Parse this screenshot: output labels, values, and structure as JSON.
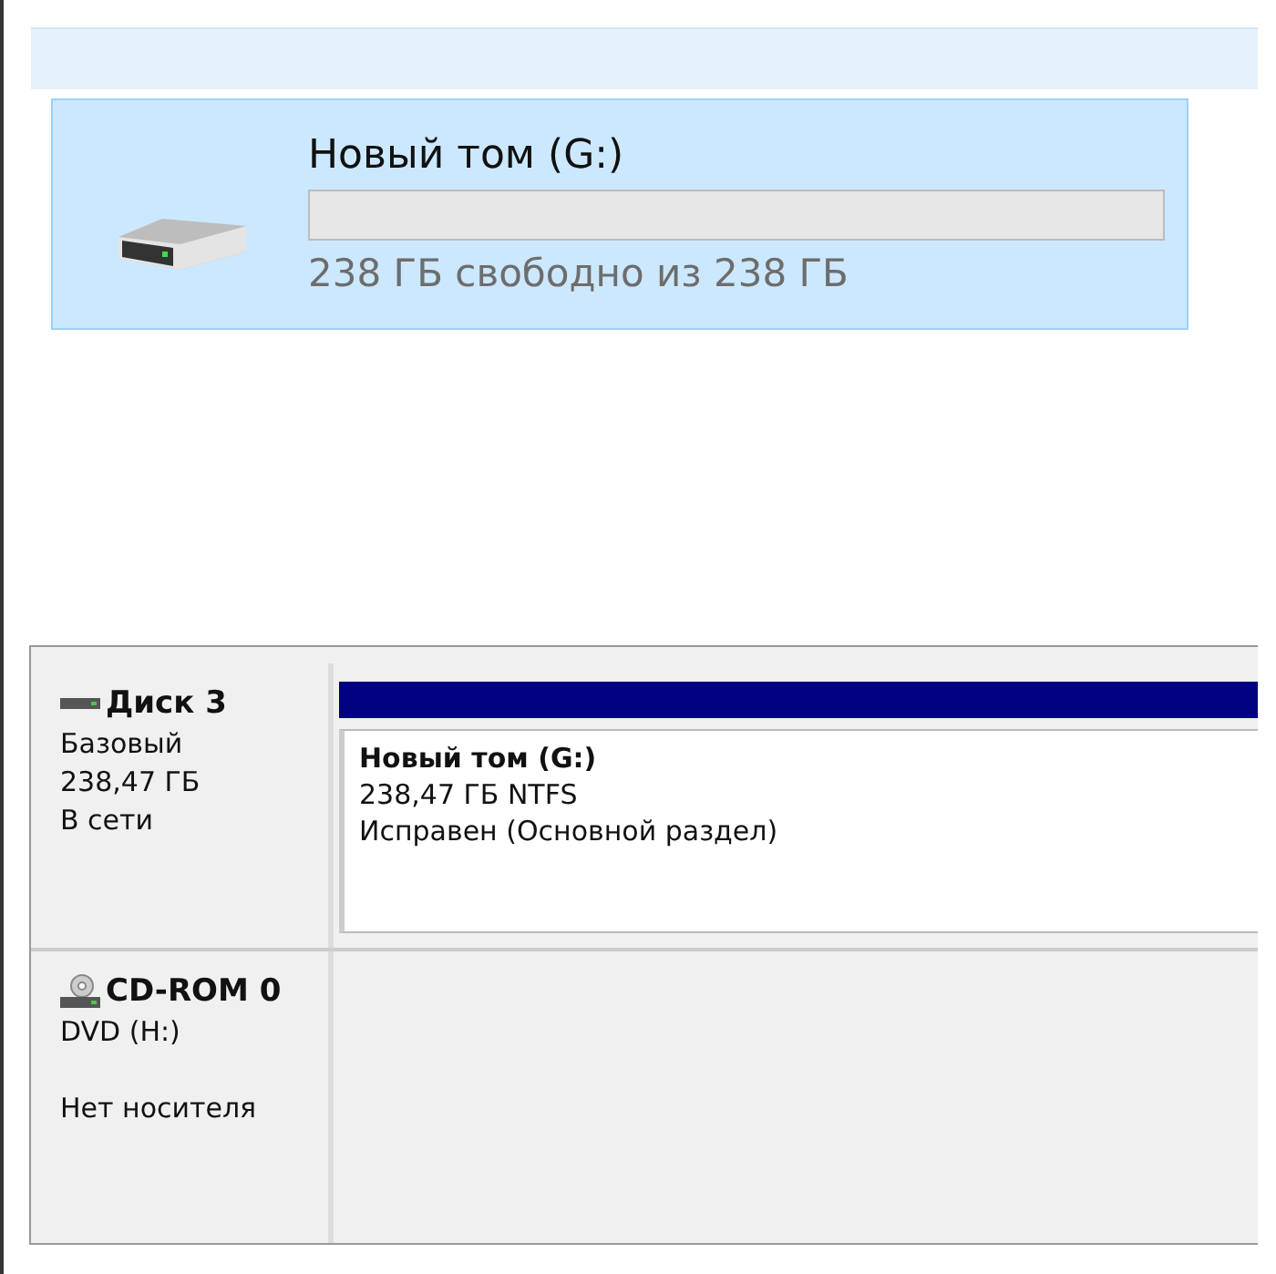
{
  "drive_tile": {
    "name": "Новый том (G:)",
    "selected": true,
    "level": 0,
    "free_text": "238 ГБ свободно из 238 ГБ"
  },
  "disks": [
    {
      "kind": "disk",
      "name": "Диск 3",
      "lines": [
        "Базовый",
        "238,47 ГБ",
        "В сети"
      ],
      "partition": {
        "name": "Новый том  (G:)",
        "size": "238,47 ГБ NTFS",
        "status": "Исправен (Основной раздел)"
      }
    },
    {
      "kind": "cdrom",
      "name": "CD-ROM 0",
      "lines": [
        "DVD (H:)"
      ],
      "note": "Нет носителя"
    }
  ]
}
